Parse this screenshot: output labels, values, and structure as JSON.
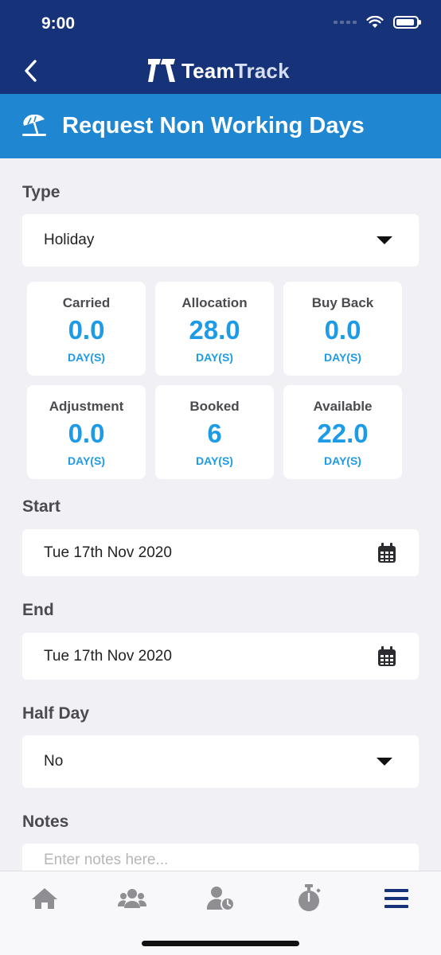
{
  "status_bar": {
    "time": "9:00"
  },
  "header": {
    "brand_bold": "Team",
    "brand_light": "Track"
  },
  "banner": {
    "title": "Request Non Working Days",
    "icon": "beach-umbrella-icon"
  },
  "form": {
    "type_label": "Type",
    "type_value": "Holiday",
    "start_label": "Start",
    "start_value": "Tue 17th Nov 2020",
    "end_label": "End",
    "end_value": "Tue 17th Nov 2020",
    "half_day_label": "Half Day",
    "half_day_value": "No",
    "notes_label": "Notes",
    "notes_placeholder": "Enter notes here..."
  },
  "stats": [
    {
      "label": "Carried",
      "value": "0.0",
      "unit": "DAY(S)"
    },
    {
      "label": "Allocation",
      "value": "28.0",
      "unit": "DAY(S)"
    },
    {
      "label": "Buy Back",
      "value": "0.0",
      "unit": "DAY(S)"
    },
    {
      "label": "Adjustment",
      "value": "0.0",
      "unit": "DAY(S)"
    },
    {
      "label": "Booked",
      "value": "6",
      "unit": "DAY(S)"
    },
    {
      "label": "Available",
      "value": "22.0",
      "unit": "DAY(S)"
    }
  ],
  "tabs": [
    {
      "icon": "home-icon"
    },
    {
      "icon": "team-icon"
    },
    {
      "icon": "user-clock-icon"
    },
    {
      "icon": "stopwatch-icon"
    },
    {
      "icon": "menu-icon",
      "active": true
    }
  ],
  "colors": {
    "header_bg": "#163278",
    "banner_bg": "#1f86d1",
    "accent": "#1e9be6",
    "page_bg": "#f1f1f5",
    "tab_active": "#163278",
    "tab_inactive": "#8e8e93"
  }
}
